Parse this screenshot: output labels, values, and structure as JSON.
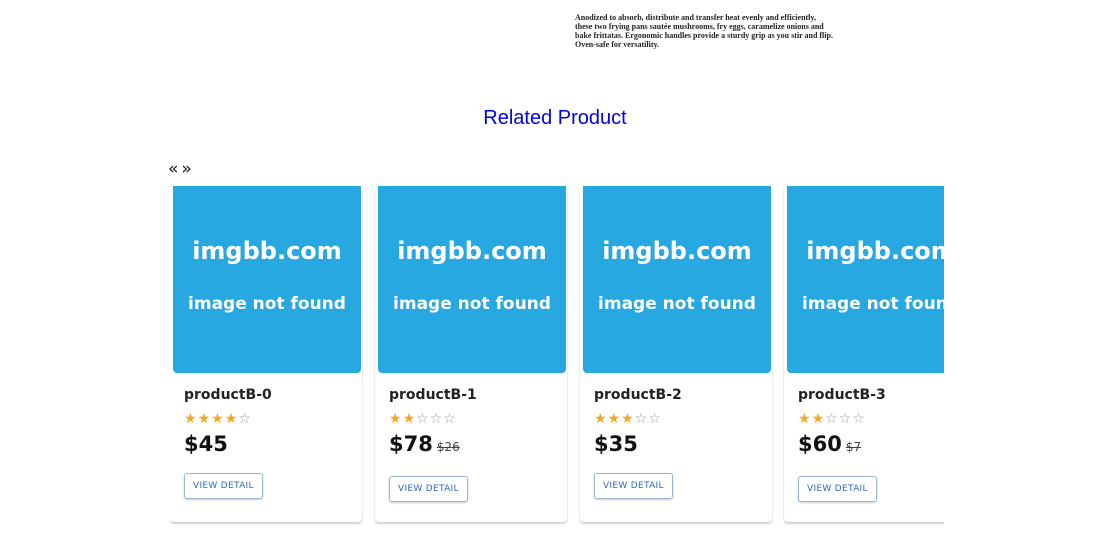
{
  "product": {
    "description_lines": [
      "Anodized to absorb, distribute and transfer heat evenly and efficiently,",
      "these two frying pans sautée mushrooms, fry eggs, caramelize onions and",
      "bake frittatas. Ergonomic handles provide a sturdy grip as you stir and flip.",
      "Oven-safe for versatility."
    ]
  },
  "related": {
    "title": "Related Product",
    "prev_label": "«",
    "next_label": "»",
    "view_detail_label": "VIEW DETAIL",
    "image_placeholder": {
      "line1": "imgbb.com",
      "line2": "image not found"
    },
    "colors": {
      "image_bg": "#28a8e1",
      "star": "#f5a623",
      "title": "#0000ee",
      "button_text": "#2d6cc0"
    },
    "products": [
      {
        "name": "productB-0",
        "rating": 4,
        "max_rating": 5,
        "price": "$45",
        "old_price": ""
      },
      {
        "name": "productB-1",
        "rating": 2,
        "max_rating": 5,
        "price": "$78",
        "old_price": "$26"
      },
      {
        "name": "productB-2",
        "rating": 3,
        "max_rating": 5,
        "price": "$35",
        "old_price": ""
      },
      {
        "name": "productB-3",
        "rating": 2,
        "max_rating": 5,
        "price": "$60",
        "old_price": "$7"
      }
    ]
  }
}
